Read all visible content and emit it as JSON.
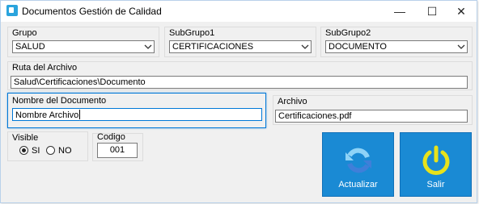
{
  "window": {
    "title": "Documentos Gestión de Calidad"
  },
  "controls": {
    "minimize": "—",
    "maximize": "☐",
    "close": "✕"
  },
  "grupo": {
    "label": "Grupo",
    "value": "SALUD"
  },
  "subgrupo1": {
    "label": "SubGrupo1",
    "value": "CERTIFICACIONES"
  },
  "subgrupo2": {
    "label": "SubGrupo2",
    "value": "DOCUMENTO"
  },
  "ruta": {
    "label": "Ruta del Archivo",
    "value": "Salud\\Certificaciones\\Documento"
  },
  "nombre": {
    "label": "Nombre del Documento",
    "value": "Nombre Archivo"
  },
  "archivo": {
    "label": "Archivo",
    "value": "Certificaciones.pdf"
  },
  "visible": {
    "label": "Visible",
    "si_label": "SI",
    "no_label": "NO",
    "selected": "SI"
  },
  "codigo": {
    "label": "Codigo",
    "value": "001"
  },
  "buttons": {
    "actualizar": "Actualizar",
    "salir": "Salir"
  },
  "colors": {
    "button_bg": "#1a8ad4",
    "focus": "#0078d7",
    "power_icon": "#e8e21b"
  },
  "icons": {
    "actualizar": "refresh-icon",
    "salir": "power-icon",
    "app": "document-app-icon"
  }
}
